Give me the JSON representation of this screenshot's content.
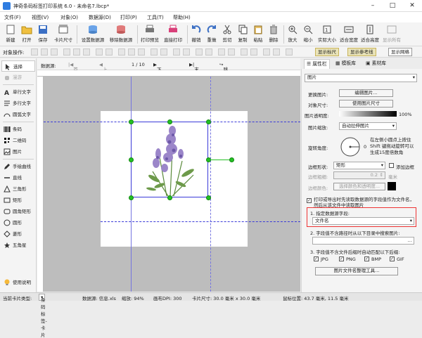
{
  "window": {
    "title": "神奇条码标签打印系统 6.0 - 未命名7.lbcp*"
  },
  "menu": [
    "文件(F)",
    "视图(V)",
    "对象(O)",
    "数据源(D)",
    "打印(P)",
    "工具(T)",
    "帮助(H)"
  ],
  "toolbar": [
    "新建",
    "打开",
    "保存",
    "卡片尺寸",
    "设置数据源",
    "移除数据源",
    "打印预览",
    "直接打印",
    "撤销",
    "重做",
    "剪切",
    "复制",
    "粘贴",
    "删除",
    "放大",
    "缩小",
    "实际大小",
    "适合宽度",
    "适合高度",
    "显示所有"
  ],
  "objbar": {
    "label": "对象操作:",
    "toggles": [
      "显示标尺",
      "显示参考线",
      "显示网格"
    ]
  },
  "tools": [
    "选择",
    "漫游",
    "单行文字",
    "多行文字",
    "圆弧文字",
    "条码",
    "二维码",
    "图片",
    "手绘曲线",
    "直线",
    "三角形",
    "矩形",
    "圆角矩形",
    "圆形",
    "菱形",
    "五角星"
  ],
  "help": "使用说明",
  "nav": {
    "datasource": "数据源:",
    "first": "首条记录",
    "prev": "上一条记录",
    "page": "1 / 10",
    "next": "下一条记录",
    "last": "末条记录",
    "jump": "跳转到记录"
  },
  "panel": {
    "tabs": [
      "属性栏",
      "模板库",
      "素材库"
    ],
    "object_type": "图片",
    "change_image_label": "更换图片:",
    "edit_image_btn": "编辑图片...",
    "object_size_label": "对象尺寸:",
    "use_image_size_btn": "使用图片尺寸",
    "transparency_label": "图片透明度:",
    "transparency_value": "100%",
    "scale_label": "图片缩放:",
    "scale_value": "自动拉伸图片",
    "rotation_label": "旋转角度:",
    "rotation_value": "0",
    "rotation_hint": "在左侧小圆点上按住Shift 键拖动旋转可以生成15度倍数角",
    "border_shape_label": "边框形状:",
    "border_shape_value": "矩形",
    "add_border_label": "添加边框",
    "border_width_label": "边框粗细:",
    "border_width_value": "0.2",
    "border_width_unit": "毫米",
    "border_color_label": "边框颜色:",
    "border_color_btn": "选择颜色和透明度...",
    "print_hint": "打印或导出时先读取数据源的字段值作为文件名，然后从该文件中读取图片",
    "field_label": "1. 指定数据源字段:",
    "field_value": "文件名",
    "dir_label": "2. 字段值不含路径时从以下目录中搜索图片:",
    "ext_label": "3. 字段值不含文件后缀时自动匹配以下后缀:",
    "exts": [
      "JPG",
      "PNG",
      "BMP",
      "GIF"
    ],
    "organize_btn": "图片文件名整理工具..."
  },
  "status": {
    "card_type_label": "当前卡片类型:",
    "card_type_value": "条码标签-卡片",
    "datasource": "数据源: 信息.xls",
    "zoom": "缩放: 94%",
    "dpi": "画布DPI: 300",
    "size": "卡片尺寸: 30.0 毫米 x 30.0 毫米",
    "coords": "鼠标位置: 43.7 毫米, 11.5 毫米"
  },
  "colors": {
    "accent": "#2f7de1",
    "handle": "#24c024",
    "guide": "#3a3ad8",
    "highlight": "#e33333"
  }
}
